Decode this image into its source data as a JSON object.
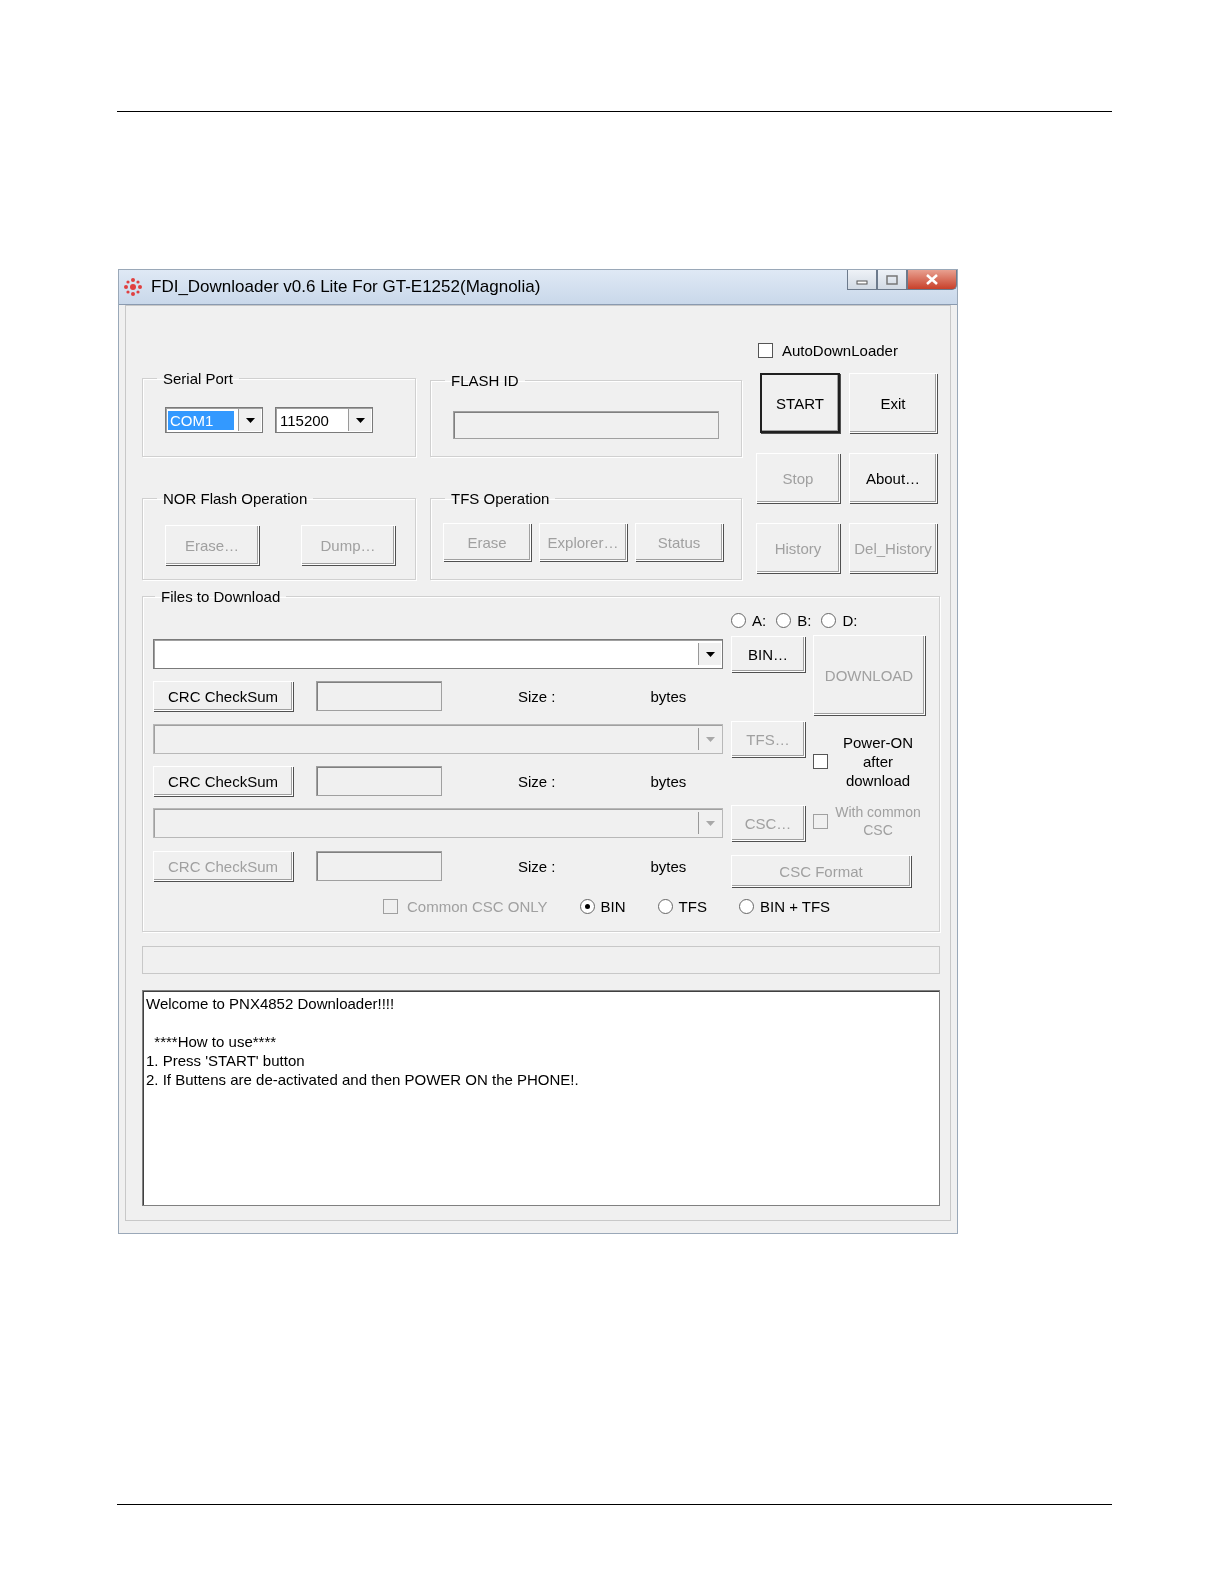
{
  "window": {
    "title": "FDI_Downloader v0.6 Lite For GT-E1252(Magnolia)"
  },
  "serial_port": {
    "title": "Serial Port",
    "port": {
      "value": "COM1",
      "highlighted": true
    },
    "baud": {
      "value": "115200",
      "highlighted": false
    }
  },
  "flash_id": {
    "title": "FLASH ID"
  },
  "nor_flash": {
    "title": "NOR Flash Operation",
    "buttons": [
      {
        "label": "Erase…",
        "disabled": true
      },
      {
        "label": "Dump…",
        "disabled": true
      }
    ]
  },
  "tfs_operation": {
    "title": "TFS Operation",
    "buttons": [
      {
        "label": "Erase",
        "disabled": true
      },
      {
        "label": "Explorer…",
        "disabled": true
      },
      {
        "label": "Status",
        "disabled": true
      }
    ]
  },
  "auto_downloader": {
    "label": "AutoDownLoader",
    "checked": false
  },
  "side_buttons": [
    {
      "label": "START",
      "disabled": false,
      "default": true
    },
    {
      "label": "Exit",
      "disabled": false,
      "default": false
    },
    {
      "label": "Stop",
      "disabled": true,
      "default": false
    },
    {
      "label": "About…",
      "disabled": false,
      "default": false
    },
    {
      "label": "History",
      "disabled": true,
      "default": false
    },
    {
      "label": "Del_History",
      "disabled": true,
      "default": false
    }
  ],
  "files": {
    "title": "Files to Download",
    "drives": [
      {
        "label": "A:",
        "selected": false
      },
      {
        "label": "B:",
        "selected": false
      },
      {
        "label": "D:",
        "selected": false
      }
    ],
    "rows": [
      {
        "disabled": false,
        "browse": "BIN…",
        "crc": "CRC CheckSum",
        "crc_disabled": false,
        "size_label": "Size :",
        "unit": "bytes"
      },
      {
        "disabled": true,
        "browse": "TFS…",
        "crc": "CRC CheckSum",
        "crc_disabled": false,
        "size_label": "Size :",
        "unit": "bytes"
      },
      {
        "disabled": true,
        "browse": "CSC…",
        "crc": "CRC CheckSum",
        "crc_disabled": true,
        "size_label": "Size :",
        "unit": "bytes"
      }
    ],
    "download": {
      "label": "DOWNLOAD",
      "disabled": true
    },
    "power_on": {
      "label": "Power-ON after download",
      "checked": false,
      "disabled": false
    },
    "common_csc": {
      "label": "With common CSC",
      "checked": false,
      "disabled": true
    },
    "csc_format": {
      "label": "CSC Format",
      "disabled": true
    },
    "common_csc_only": {
      "label": "Common CSC ONLY",
      "checked": false,
      "disabled": true
    },
    "modes": [
      {
        "label": "BIN",
        "selected": true
      },
      {
        "label": "TFS",
        "selected": false
      },
      {
        "label": "BIN + TFS",
        "selected": false
      }
    ]
  },
  "log": {
    "paragraphs": [
      [
        "Welcome to PNX4852 Downloader!!!!"
      ],
      [
        "  ****How to use****",
        "1. Press 'START' button",
        "2. If Buttens are de-activated and then POWER ON the PHONE!."
      ]
    ]
  }
}
